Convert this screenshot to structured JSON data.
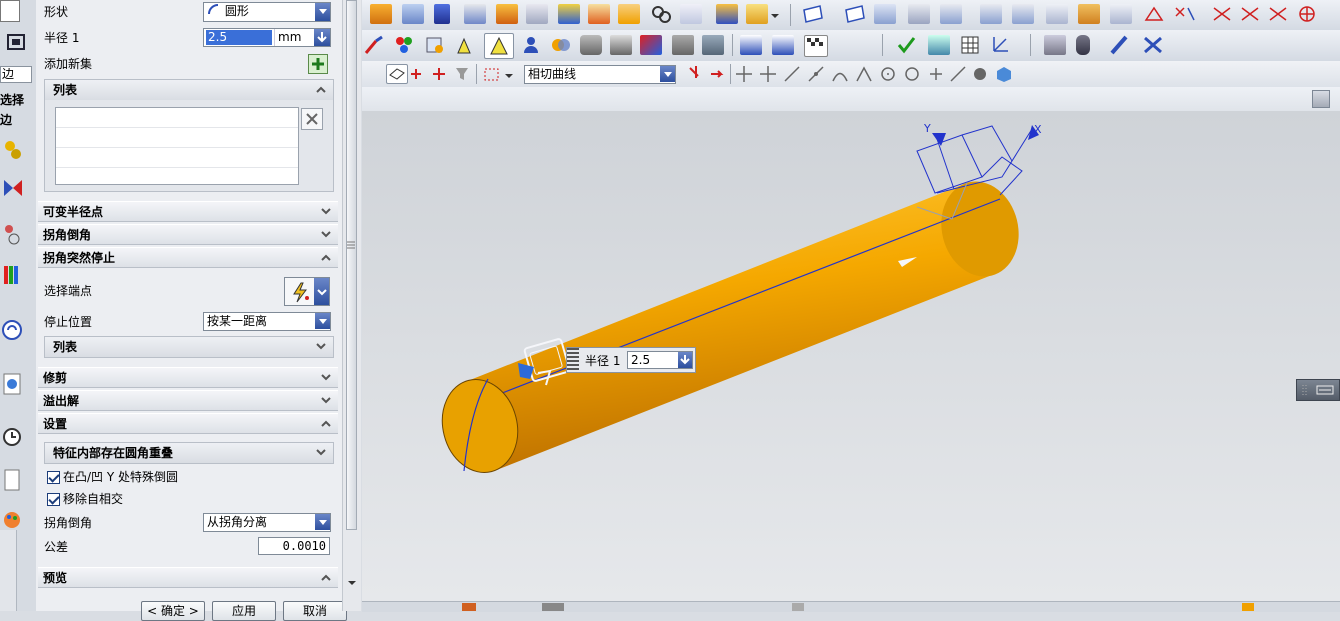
{
  "dialog": {
    "shape_label": "形状",
    "shape_value": "圆形",
    "radius_label": "半径 1",
    "radius_value": "2.5",
    "radius_unit": "mm",
    "add_new_set_label": "添加新集",
    "list_label": "列表",
    "sections": {
      "variable_radius": "可变半径点",
      "corner_setback": "拐角倒角",
      "corner_stop": "拐角突然停止",
      "trim": "修剪",
      "overflow": "溢出解",
      "settings": "设置",
      "preview": "预览"
    },
    "corner_stop": {
      "select_endpoint_label": "选择端点",
      "stop_position_label": "停止位置",
      "stop_position_value": "按某一距离",
      "list_label": "列表"
    },
    "settings": {
      "group_label": "特征内部存在圆角重叠",
      "checkbox1_label": "在凸/凹 Y 处特殊倒圆",
      "checkbox2_label": "移除自相交",
      "corner_setback_label": "拐角倒角",
      "corner_setback_value": "从拐角分离",
      "tolerance_label": "公差",
      "tolerance_value": "0.0010"
    },
    "buttons": {
      "ok": "< 确定 >",
      "apply": "应用",
      "cancel": "取消"
    }
  },
  "left_strip": {
    "label1": "边",
    "label2": "选择边"
  },
  "toolbar3": {
    "curve_rule_value": "相切曲线"
  },
  "viewport": {
    "radius_popup_label": "半径 1",
    "radius_popup_value": "2.5",
    "axis_x": "X",
    "axis_y": "Y"
  },
  "colors": {
    "cylinder": "#f2a900",
    "accent": "#2d4f9e",
    "edge": "#2233cc"
  }
}
